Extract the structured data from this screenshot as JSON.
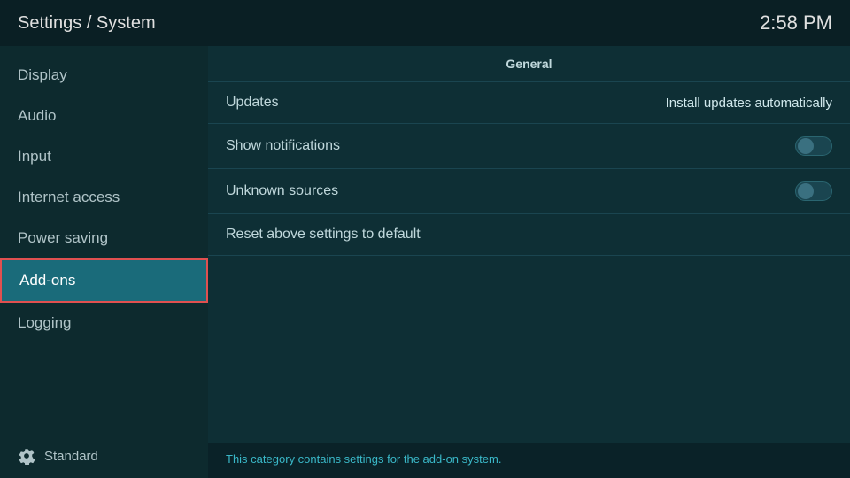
{
  "header": {
    "title": "Settings / System",
    "time": "2:58 PM"
  },
  "sidebar": {
    "items": [
      {
        "id": "display",
        "label": "Display",
        "active": false
      },
      {
        "id": "audio",
        "label": "Audio",
        "active": false
      },
      {
        "id": "input",
        "label": "Input",
        "active": false
      },
      {
        "id": "internet-access",
        "label": "Internet access",
        "active": false
      },
      {
        "id": "power-saving",
        "label": "Power saving",
        "active": false
      },
      {
        "id": "add-ons",
        "label": "Add-ons",
        "active": true
      },
      {
        "id": "logging",
        "label": "Logging",
        "active": false
      }
    ],
    "footer": {
      "icon": "gear-icon",
      "label": "Standard"
    }
  },
  "content": {
    "section_label": "General",
    "rows": [
      {
        "id": "updates",
        "label": "Updates",
        "value": "Install updates automatically",
        "control": "text"
      },
      {
        "id": "show-notifications",
        "label": "Show notifications",
        "value": "",
        "control": "toggle"
      },
      {
        "id": "unknown-sources",
        "label": "Unknown sources",
        "value": "",
        "control": "toggle"
      },
      {
        "id": "reset-settings",
        "label": "Reset above settings to default",
        "value": "",
        "control": "none"
      }
    ],
    "status_text": "This category contains settings for the add-on system."
  }
}
